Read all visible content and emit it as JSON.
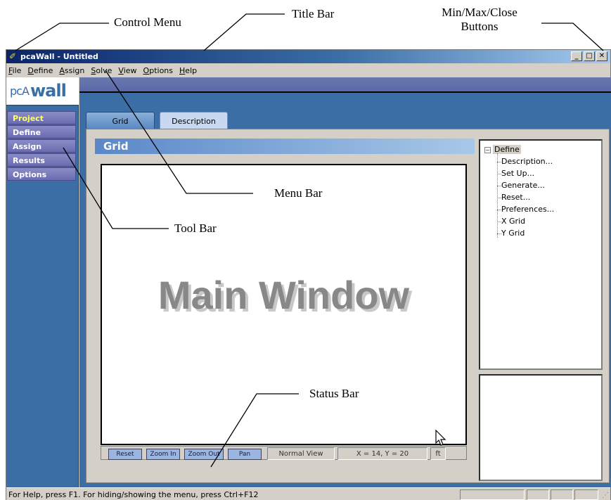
{
  "annotations": {
    "control_menu": "Control Menu",
    "title_bar": "Title Bar",
    "min_max_close_line1": "Min/Max/Close",
    "min_max_close_line2": "Buttons",
    "menu_bar": "Menu Bar",
    "tool_bar": "Tool Bar",
    "status_bar": "Status Bar"
  },
  "window": {
    "title": "pcaWall - Untitled",
    "buttons": {
      "minimize": "_",
      "maximize": "□",
      "close": "✕"
    }
  },
  "menu": [
    "File",
    "Define",
    "Assign",
    "Solve",
    "View",
    "Options",
    "Help"
  ],
  "logo": {
    "prefix": "pcA",
    "name": "wall"
  },
  "toolbar": [
    "Project",
    "Define",
    "Assign",
    "Results",
    "Options"
  ],
  "tabs": [
    "Grid",
    "Description"
  ],
  "grid_header": "Grid",
  "main_label": "Main Window",
  "tree": {
    "root": "Define",
    "expander": "−",
    "children": [
      "Description...",
      "Set Up...",
      "Generate...",
      "Reset...",
      "Preferences...",
      "X Grid",
      "Y Grid"
    ]
  },
  "canvas_status": {
    "buttons": [
      "Reset",
      "Zoom In",
      "Zoom Out",
      "Pan"
    ],
    "view_mode": "Normal View",
    "coords": "X = 14, Y = 20",
    "units": "ft"
  },
  "status_bar_text": "For Help, press F1. For hiding/showing the menu, press Ctrl+F12"
}
